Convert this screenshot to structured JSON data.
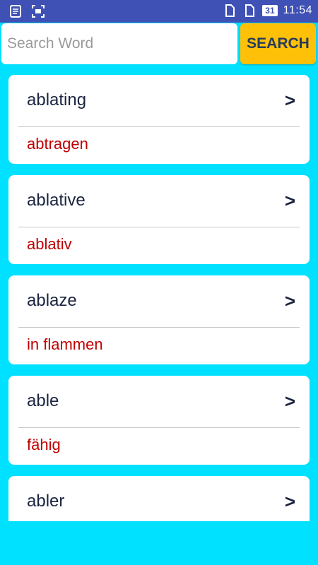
{
  "status_bar": {
    "left_icons": [
      "notes-icon",
      "screenshot-icon"
    ],
    "right_icons": [
      "sim-card-icon",
      "sim-card-2-icon"
    ],
    "battery": "31",
    "time": "11:54"
  },
  "search": {
    "placeholder": "Search Word",
    "value": "",
    "button_label": "SEARCH"
  },
  "entries": [
    {
      "word": "ablating",
      "translation": "abtragen",
      "chevron": ">"
    },
    {
      "word": "ablative",
      "translation": "ablativ",
      "chevron": ">"
    },
    {
      "word": "ablaze",
      "translation": "in flammen",
      "chevron": ">"
    },
    {
      "word": "able",
      "translation": "fähig",
      "chevron": ">"
    },
    {
      "word": "abler",
      "translation": "",
      "chevron": ">"
    }
  ],
  "colors": {
    "background": "#00E0FF",
    "status_bar": "#3F51B5",
    "search_button": "#FFC107",
    "word_text": "#1a2440",
    "translation_text": "#C00000"
  }
}
